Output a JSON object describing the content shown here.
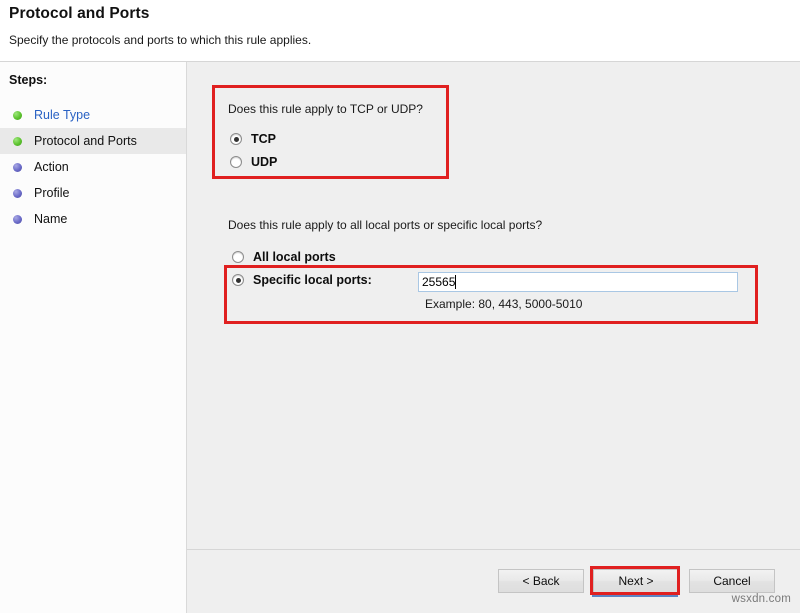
{
  "header": {
    "title": "Protocol and Ports",
    "subtitle": "Specify the protocols and ports to which this rule applies."
  },
  "sidebar": {
    "heading": "Steps:",
    "items": [
      {
        "label": "Rule Type",
        "state": "done",
        "bullet_color": "#5cc22e"
      },
      {
        "label": "Protocol and Ports",
        "state": "current",
        "bullet_color": "#5cc22e"
      },
      {
        "label": "Action",
        "state": "pending",
        "bullet_color": "#6b6bc8"
      },
      {
        "label": "Profile",
        "state": "pending",
        "bullet_color": "#6b6bc8"
      },
      {
        "label": "Name",
        "state": "pending",
        "bullet_color": "#6b6bc8"
      }
    ]
  },
  "main": {
    "protocol": {
      "question": "Does this rule apply to TCP or UDP?",
      "options": [
        {
          "label": "TCP",
          "selected": true
        },
        {
          "label": "UDP",
          "selected": false
        }
      ]
    },
    "ports": {
      "question": "Does this rule apply to all local ports or specific local ports?",
      "options": [
        {
          "label": "All local ports",
          "selected": false
        },
        {
          "label": "Specific local ports:",
          "selected": true
        }
      ],
      "input_value": "25565",
      "example": "Example: 80, 443, 5000-5010"
    }
  },
  "footer": {
    "back_label": "< Back",
    "next_label": "Next >",
    "cancel_label": "Cancel"
  },
  "watermark": "wsxdn.com",
  "annotations": {
    "color": "#e02020",
    "boxes": [
      "protocol-section",
      "specific-local-ports-row",
      "next-button"
    ]
  }
}
